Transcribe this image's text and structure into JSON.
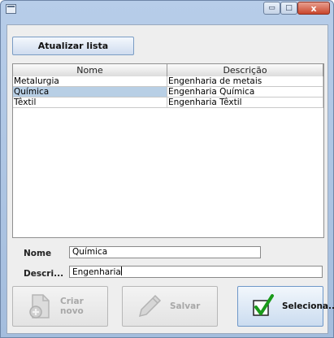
{
  "window": {
    "controls": {
      "minimize": "▭",
      "maximize": "□",
      "close": "x"
    }
  },
  "toolbar": {
    "refresh_label": "Atualizar lista"
  },
  "table": {
    "columns": [
      "Nome",
      "Descrição"
    ],
    "rows": [
      {
        "nome": "Metalurgia",
        "descricao": "Engenharia de metais"
      },
      {
        "nome": "Química",
        "descricao": "Engenharia Química"
      },
      {
        "nome": "Têxtil",
        "descricao": "Engenharia Têxtil"
      }
    ],
    "selected_row": 1
  },
  "form": {
    "nome_label": "Nome",
    "nome_value": "Química",
    "descricao_label": "Descri...",
    "descricao_value": "Engenharia"
  },
  "actions": {
    "create_label": "Criar novo",
    "save_label": "Salvar",
    "select_label": "Seleciona..."
  },
  "icons": {
    "create": "document-add-icon",
    "save": "pencil-icon",
    "select": "checkmark-icon"
  },
  "colors": {
    "selection": "#b8cfe5",
    "accent_check": "#1a9a1a",
    "disabled_text": "#a8a8a8"
  }
}
